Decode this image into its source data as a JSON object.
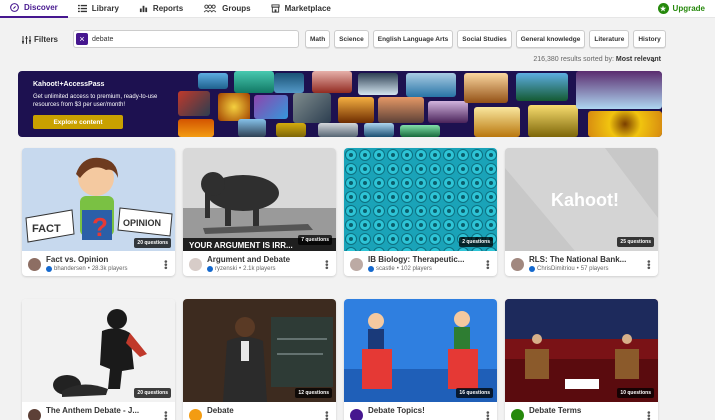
{
  "nav": {
    "items": [
      {
        "label": "Discover",
        "icon": "compass-icon",
        "active": true
      },
      {
        "label": "Library",
        "icon": "list-icon"
      },
      {
        "label": "Reports",
        "icon": "bar-chart-icon"
      },
      {
        "label": "Groups",
        "icon": "people-icon"
      },
      {
        "label": "Marketplace",
        "icon": "store-icon"
      }
    ],
    "upgrade_label": "Upgrade"
  },
  "filters": {
    "button_label": "Filters",
    "search_value": "debate",
    "chips": [
      "Math",
      "Science",
      "English Language Arts",
      "Social Studies",
      "General knowledge",
      "Literature",
      "History"
    ],
    "results_text": "216,380 results sorted by:",
    "sort_value": "Most relevant"
  },
  "banner": {
    "logo": "Kahoot!+AccessPass",
    "text": "Get unlimited access to premium, ready-to-use resources from $3 per user/month!",
    "cta": "Explore content"
  },
  "cards": [
    {
      "title": "Fact vs. Opinion",
      "author": "bhandersen",
      "players": "28.3k players",
      "questions": "20 questions"
    },
    {
      "title": "Argument and Debate",
      "author": "ryzenski",
      "players": "2.1k players",
      "questions": "7 questions"
    },
    {
      "title": "IB Biology: Therapeutic...",
      "author": "scastle",
      "players": "102 players",
      "questions": "2 questions"
    },
    {
      "title": "RLS: The National Bank...",
      "author": "ChrisDimitriou",
      "players": "57 players",
      "questions": "25 questions"
    },
    {
      "title": "The Anthem Debate - J...",
      "author": "",
      "players": "",
      "questions": "20 questions"
    },
    {
      "title": "Debate",
      "author": "",
      "players": "",
      "questions": "12 questions"
    },
    {
      "title": "Debate Topics!",
      "author": "",
      "players": "",
      "questions": "16 questions"
    },
    {
      "title": "Debate Terms",
      "author": "",
      "players": "",
      "questions": "10 questions"
    }
  ],
  "thumb_text": {
    "fact": "FACT",
    "opinion": "OPINION",
    "argument": "YOUR ARGUMENT IS IRR...",
    "kahoot": "Kahoot!"
  },
  "colors": {
    "brand": "#46178f",
    "upgrade": "#26890c",
    "banner_bg": "#1d1150",
    "cta": "#c9a100"
  }
}
